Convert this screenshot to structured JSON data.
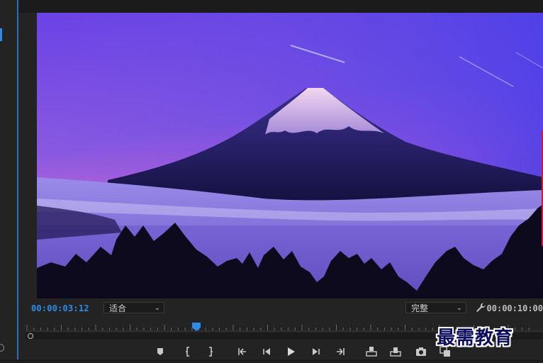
{
  "monitor": {
    "current_timecode": "00:00:03:12",
    "duration_timecode": "00:00:10:00",
    "zoom_select": {
      "value": "适合"
    },
    "resolution_select": {
      "value": "完整"
    },
    "playhead_fraction": 0.33
  },
  "controls": {
    "icons": [
      "marker-icon",
      "mark-in-icon",
      "mark-out-icon",
      "go-to-in-icon",
      "step-back-icon",
      "play-icon",
      "step-forward-icon",
      "go-to-out-icon",
      "insert-icon",
      "overwrite-icon",
      "export-frame-icon",
      "button-editor-icon"
    ]
  },
  "watermark": {
    "text": "最需教育"
  },
  "colors": {
    "accent": "#2d8ceb",
    "panel": "#232323"
  }
}
